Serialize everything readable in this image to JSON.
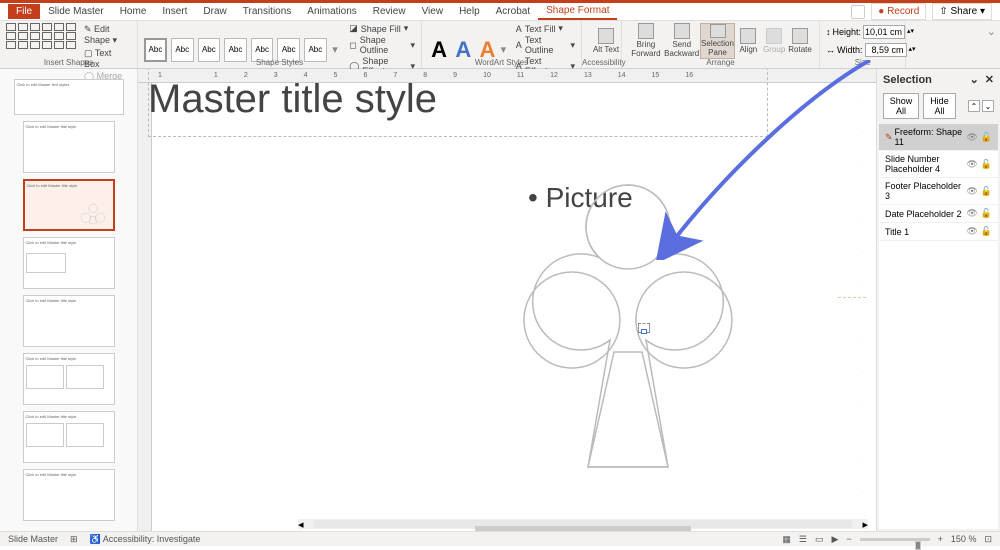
{
  "tabs": {
    "file": "File",
    "slideMaster": "Slide Master",
    "home": "Home",
    "insert": "Insert",
    "draw": "Draw",
    "transitions": "Transitions",
    "animations": "Animations",
    "review": "Review",
    "view": "View",
    "help": "Help",
    "acrobat": "Acrobat",
    "shapeFormat": "Shape Format"
  },
  "topRight": {
    "record": "Record",
    "share": "Share"
  },
  "ribbon": {
    "insertShapes": {
      "label": "Insert Shapes",
      "editShape": "Edit Shape",
      "textBox": "Text Box",
      "mergeShapes": "Merge Shapes"
    },
    "shapeStyles": {
      "label": "Shape Styles",
      "preset": "Abc",
      "fill": "Shape Fill",
      "outline": "Shape Outline",
      "effects": "Shape Effects"
    },
    "wordArt": {
      "label": "WordArt Styles",
      "textFill": "Text Fill",
      "textOutline": "Text Outline",
      "textEffects": "Text Effects"
    },
    "accessibility": {
      "label": "Accessibility",
      "altText": "Alt Text"
    },
    "arrange": {
      "label": "Arrange",
      "bringForward": "Bring Forward",
      "sendBackward": "Send Backward",
      "selectionPane": "Selection Pane",
      "align": "Align",
      "group": "Group",
      "rotate": "Rotate"
    },
    "size": {
      "label": "Size",
      "heightLabel": "Height:",
      "height": "10,01 cm",
      "widthLabel": "Width:",
      "width": "8,59 cm"
    }
  },
  "slide": {
    "title": "Master title style",
    "bullet": "• Picture"
  },
  "thumbs": {
    "t1": "Click to edit Master text styles",
    "t2": "Click to edit Master title style",
    "t3": "Click to edit Master title style",
    "t4": "Click to edit Master title style",
    "t5": "Click to edit Master title style",
    "t6": "Click to edit Master title style",
    "t7": "Click to edit Master title style",
    "t8": "Click to edit Master title style"
  },
  "selectionPane": {
    "title": "Selection",
    "showAll": "Show All",
    "hideAll": "Hide All",
    "items": [
      "Freeform: Shape 11",
      "Slide Number Placeholder 4",
      "Footer Placeholder 3",
      "Date Placeholder 2",
      "Title 1"
    ]
  },
  "status": {
    "mode": "Slide Master",
    "accessibility": "Accessibility: Investigate",
    "zoom": "150 %"
  },
  "rulerH": [
    "1",
    "",
    "1",
    "2",
    "3",
    "4",
    "5",
    "6",
    "7",
    "8",
    "9",
    "10",
    "11",
    "12",
    "13",
    "14",
    "15",
    "16"
  ]
}
